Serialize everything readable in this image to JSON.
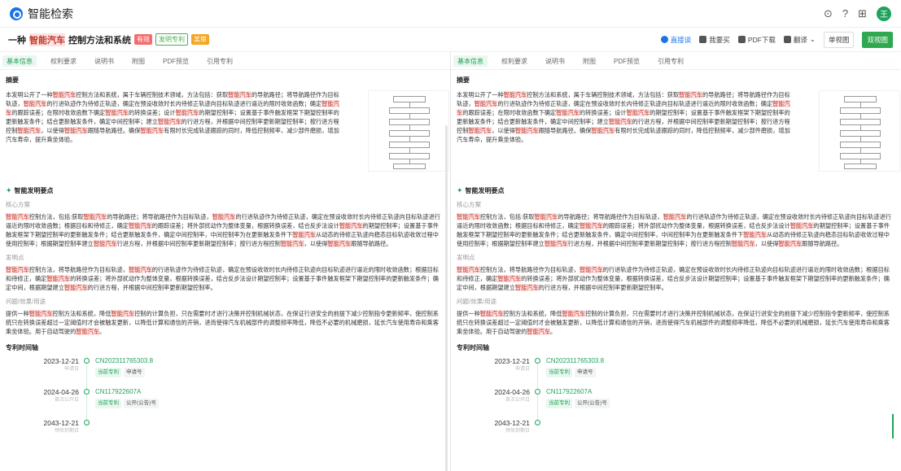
{
  "app": {
    "title": "智能检索"
  },
  "top_icons": [
    "chat-icon",
    "help-icon",
    "apps-icon"
  ],
  "user": {
    "avatar": "王"
  },
  "doc": {
    "title_prefix": "一种",
    "title_hl": "智能汽车",
    "title_suffix": "控制方法和系统",
    "badges": [
      "有效",
      "发明专利",
      "某审"
    ]
  },
  "actions": {
    "direct": "直接谈",
    "buy": "我要买",
    "pdf": "PDF下载",
    "translate": "翻译",
    "single": "单视图",
    "dual": "双视图"
  },
  "tabs": [
    "基本信息",
    "权利要求",
    "说明书",
    "附图",
    "PDF预览",
    "引用专利"
  ],
  "abstract": {
    "heading": "摘要",
    "text": "本发明公开了一种智能汽车控制方法和系统，属于车辆控制技术领域，方法包括：获取智能汽车的导航路径；将导航路径作为目标轨迹，智能汽车的行进轨迹作为待修正轨迹，确定在预设收敛时长内待修正轨迹向目标轨迹进行逼近的限时收敛函数；确定智能汽车的跟踪误差；在限时收敛函数下确定智能汽车的转换误差；设计智能汽车的期望控制率；设置基于事件触发框架下期望控制率的更新触发条件；结合更新触发条件，确定中间控制率；建立智能汽车的行进方程，并根据中间控制率更新期望控制率；按行进方程控制智能汽车，以使得智能汽车跟随导航路径。确保智能汽车有限时长完成轨迹跟踪的同时，降低控制频率，减少部件磨损，增加汽车寿命，提升乘坐体验。"
  },
  "highlights": {
    "heading": "智能发明要点",
    "core_label": "核心方案",
    "core_text": "智能汽车控制方法，包括:获取智能汽车的导航路径；将导航路径作为目标轨迹，智能汽车的行进轨迹作为待修正轨迹，确定在预设收敛时长内待修正轨迹向目标轨迹进行逼近的限时收敛函数；根据目标和待修正，确定智能汽车的跟踪误差；将外部扰动作为整体变量，根据转换误差，结合反步法设计智能汽车的期望控制率；设置基于事件触发框架下期望控制率的更新触发条件；结合更新触发条件，确定中间控制率，中间控制率为在更新触发条件下智能汽车从动态的待修正轨迹向稳态目标轨迹收敛过程中使用控制率；根据期望控制率建立智能汽车行进方程，并根据中间控制率更新期望控制率；按行进方程控制智能汽车，以使得智能汽车跟随导航路径。",
    "point_label": "发明点",
    "point_text": "智能汽车控制方法，将导航路径作为目标轨迹，智能汽车的行进轨迹作为待修正轨迹，确定在预设收敛时长内待修正轨迹向目标轨迹进行逼近的限时收敛函数；根据目标和待修正，确定智能汽车的转换误差；将外部扰动作为整体变量，根据转换误差，结合反步法设计期望控制率；设置基于事件触发框架下期望控制率的更新触发条件；确定中间，根据期望建立智能汽车的行进方程，并根据中间控制率更新期望控制率。",
    "effect_label": "问题/效果/用途",
    "effect_text": "提供一种智能汽车控制方法和系统，降低智能汽车控制的计算负担，只在需要时才进行决策并控制机械状态，在保证行进安全的前提下减少控制指令更新频率，使控制系统只在转换误差超过一定阈值时才会被触发更新，以降低计算和通信的开销，进而使得汽车机械部件的调整频率降低，降低不必要的机械磨损，延长汽车使用寿命和乘客乘坐体验。用于自动驾驶的智能汽车。"
  },
  "timeline": {
    "heading": "专利时间轴",
    "items": [
      {
        "date": "2023-12-21",
        "sub": "申请日",
        "number": "CN202311765303.8",
        "tags": [
          "当前专利",
          "申请号"
        ]
      },
      {
        "date": "2024-04-26",
        "sub": "首次公开日",
        "number": "CN117922607A",
        "tags": [
          "当前专利",
          "公开(公告)号"
        ]
      },
      {
        "date": "2043-12-21",
        "sub": "预估到期日",
        "number": "",
        "tags": []
      }
    ]
  }
}
